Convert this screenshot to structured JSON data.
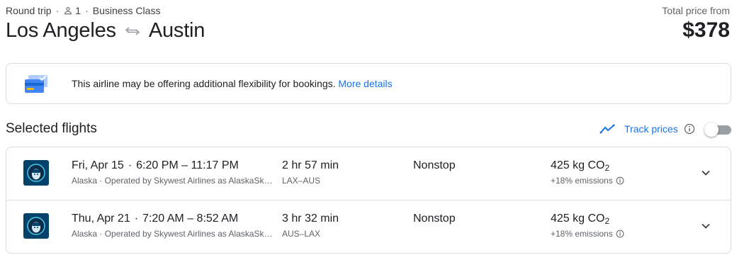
{
  "header": {
    "trip_type": "Round trip",
    "passengers": "1",
    "cabin": "Business Class",
    "origin": "Los Angeles",
    "destination": "Austin",
    "price_label": "Total price from",
    "price": "$378"
  },
  "banner": {
    "text": "This airline may be offering additional flexibility for bookings.",
    "link": "More details"
  },
  "section": {
    "title": "Selected flights",
    "track_label": "Track prices",
    "track_enabled": false
  },
  "flights": [
    {
      "date": "Fri, Apr 15",
      "times": "6:20 PM – 11:17 PM",
      "carrier": "Alaska · Operated by Skywest Airlines as AlaskaSkywest",
      "duration": "2 hr 57 min",
      "airports": "LAX–AUS",
      "stops": "Nonstop",
      "co2": "425 kg CO",
      "co2_sub": "2",
      "emissions": "+18% emissions"
    },
    {
      "date": "Thu, Apr 21",
      "times": "7:20 AM – 8:52 AM",
      "carrier": "Alaska · Operated by Skywest Airlines as AlaskaSkywest",
      "duration": "3 hr 32 min",
      "airports": "AUS–LAX",
      "stops": "Nonstop",
      "co2": "425 kg CO",
      "co2_sub": "2",
      "emissions": "+18% emissions"
    }
  ],
  "icons": {
    "person": "person-icon",
    "swap": "swap-arrows-icon",
    "banner": "ticket-check-icon",
    "track": "trend-line-icon",
    "info": "info-icon",
    "airline": "alaska-airlines-logo",
    "expand": "chevron-down-icon"
  },
  "colors": {
    "link": "#1a73e8",
    "alaska_navy": "#01426a"
  }
}
